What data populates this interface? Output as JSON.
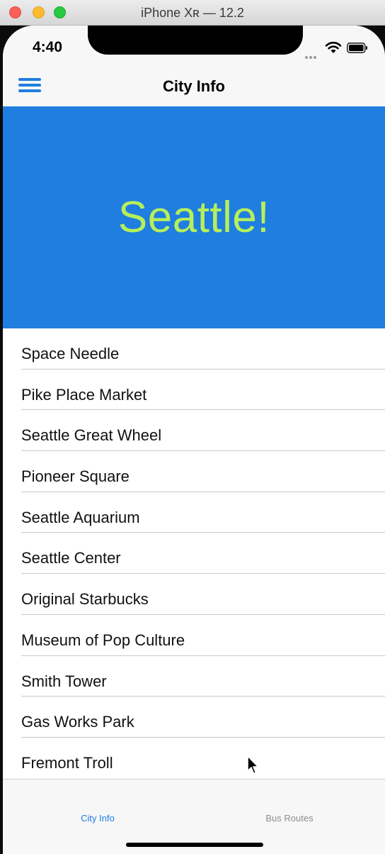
{
  "window": {
    "title": "iPhone Xʀ — 12.2",
    "controls": [
      "close",
      "minimize",
      "zoom"
    ]
  },
  "status_bar": {
    "time": "4:40",
    "icons": [
      "signal-icon",
      "wifi-icon",
      "battery-icon"
    ]
  },
  "nav": {
    "title": "City Info",
    "menu_icon": "hamburger-menu-icon"
  },
  "banner": {
    "text": "Seattle!",
    "background": "#1f7ee0",
    "text_color": "#b7ef5a"
  },
  "places": [
    "Space Needle",
    "Pike Place Market",
    "Seattle Great Wheel",
    "Pioneer Square",
    "Seattle Aquarium",
    "Seattle Center",
    "Original Starbucks",
    "Museum of Pop Culture",
    "Smith Tower",
    "Gas Works Park",
    "Fremont Troll"
  ],
  "tabs": [
    {
      "label": "City Info",
      "active": true,
      "color": "#1f7ee0"
    },
    {
      "label": "Bus Routes",
      "active": false,
      "color": "#8e8e93"
    }
  ]
}
